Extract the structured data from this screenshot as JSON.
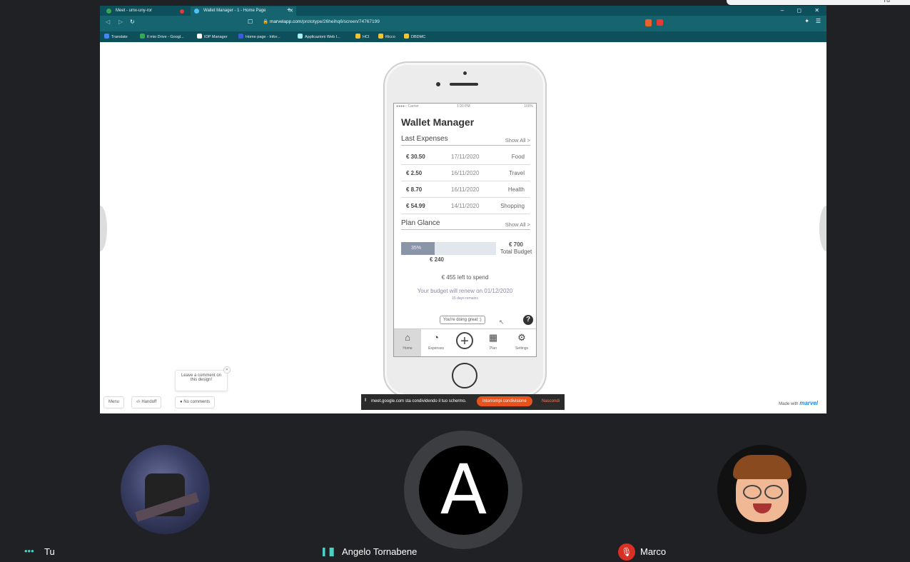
{
  "browser": {
    "tabs": [
      {
        "label": "Meet - umx-uny-ror"
      },
      {
        "label": "Wallet Manager - 1 - Home Page"
      }
    ],
    "new_tab": "+",
    "window_controls": "–  ◻  ✕",
    "address": {
      "domain": "marvelapp.com",
      "path": "/prototype/26heihq6/screen/74767199"
    },
    "bookmarks": [
      "Translate",
      "Il mio Drive - Googl...",
      "IOP Manager",
      "Home page - Infor...",
      "Applicazioni Web I...",
      "HCI",
      "Ricco",
      "DBDMC"
    ]
  },
  "topright_label": "Tu",
  "phone": {
    "status": {
      "carrier": "●●●●○ Carrier",
      "time": "1:20 PM",
      "battery": "100%"
    },
    "title": "Wallet Manager",
    "last_expenses": {
      "heading": "Last Expenses",
      "show_all": "Show All >",
      "rows": [
        {
          "amount": "€ 30.50",
          "date": "17/11/2020",
          "category": "Food"
        },
        {
          "amount": "€ 2.50",
          "date": "16/11/2020",
          "category": "Travel"
        },
        {
          "amount": "€ 8.70",
          "date": "16/11/2020",
          "category": "Health"
        },
        {
          "amount": "€ 54.99",
          "date": "14/11/2020",
          "category": "Shopping"
        }
      ]
    },
    "plan": {
      "heading": "Plan Glance",
      "show_all": "Show All >",
      "percent_label": "35%",
      "percent": 35,
      "spent": "€ 240",
      "budget_amount": "€ 700",
      "budget_label": "Total Budget",
      "left": "€ 455 left to spend",
      "renew": "Your budget will renew on 01/12/2020",
      "days": "15 days remains"
    },
    "tooltip": "You're doing great :)",
    "help": "?",
    "nav": [
      {
        "label": "Home"
      },
      {
        "label": "Expenses"
      },
      {
        "label": ""
      },
      {
        "label": "Plan"
      },
      {
        "label": "Settings"
      }
    ]
  },
  "marvel": {
    "comment_tip": "Leave a comment on this design!",
    "menu": "Menu",
    "handoff": "Handoff",
    "comments": "No comments",
    "made_with": "Made with",
    "brand": "marvel"
  },
  "sharebar": {
    "text": "meet.google.com sta condividendo il tuo schermo.",
    "stop": "Interrompi condivisione",
    "hide": "Nascondi"
  },
  "participants": [
    {
      "name": "Tu"
    },
    {
      "name": "Angelo Tornabene",
      "initial": "A"
    },
    {
      "name": "Marco"
    }
  ]
}
